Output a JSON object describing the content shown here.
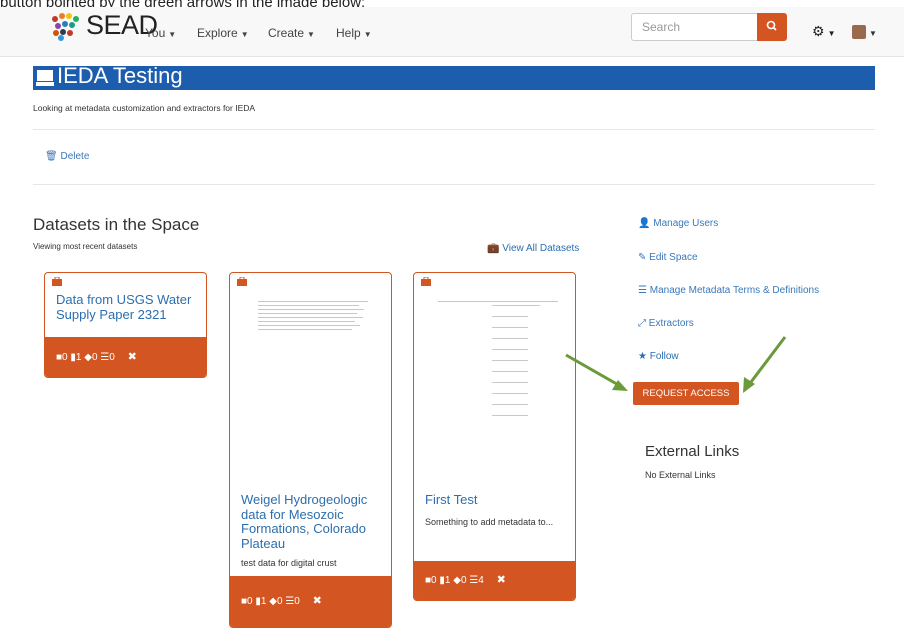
{
  "caption": "button pointed by the green arrows in the image below:",
  "navbar": {
    "brand": "SEAD",
    "menu": [
      {
        "label": "You",
        "icon": "caret-down-icon"
      },
      {
        "label": "Explore",
        "icon": "caret-down-icon"
      },
      {
        "label": "Create",
        "icon": "caret-down-icon"
      },
      {
        "label": "Help",
        "icon": "caret-down-icon"
      }
    ],
    "search_placeholder": "Search",
    "search_icon": "search-icon",
    "settings_icon": "gear-icon",
    "user_icon": "avatar"
  },
  "space": {
    "icon": "drive-icon",
    "title": "IEDA Testing",
    "description": "Looking at metadata customization and extractors for IEDA",
    "delete_label": "Delete",
    "delete_icon": "trash-icon"
  },
  "datasets": {
    "title": "Datasets in the Space",
    "subtitle": "Viewing most recent datasets",
    "view_all_label": "View All Datasets",
    "view_all_icon": "briefcase-icon",
    "cards": [
      {
        "title": "Data from USGS Water Supply Paper 2321",
        "description": "",
        "folders": "0",
        "files": "1",
        "tags": "0",
        "metadata": "0"
      },
      {
        "title": "Weigel Hydrogeologic data for Mesozoic Formations, Colorado Plateau",
        "description": "test data for digital crust",
        "folders": "0",
        "files": "1",
        "tags": "0",
        "metadata": "0"
      },
      {
        "title": "First Test",
        "description": "Something to add metadata to...",
        "folders": "0",
        "files": "1",
        "tags": "0",
        "metadata": "4"
      }
    ]
  },
  "sidebar": {
    "links": [
      {
        "label": "Manage Users",
        "icon": "user-icon"
      },
      {
        "label": "Edit Space",
        "icon": "edit-icon"
      },
      {
        "label": "Manage Metadata Terms & Definitions",
        "icon": "list-icon"
      },
      {
        "label": "Extractors",
        "icon": "expand-icon"
      },
      {
        "label": "Follow",
        "icon": "star-icon"
      }
    ],
    "request_access_label": "REQUEST ACCESS",
    "external_links_title": "External Links",
    "external_links_empty": "No External Links"
  },
  "colors": {
    "brand_blue": "#1c5dad",
    "accent_orange": "#d35521",
    "link_blue": "#2c6eae",
    "arrow_green": "#6a9a3a"
  }
}
